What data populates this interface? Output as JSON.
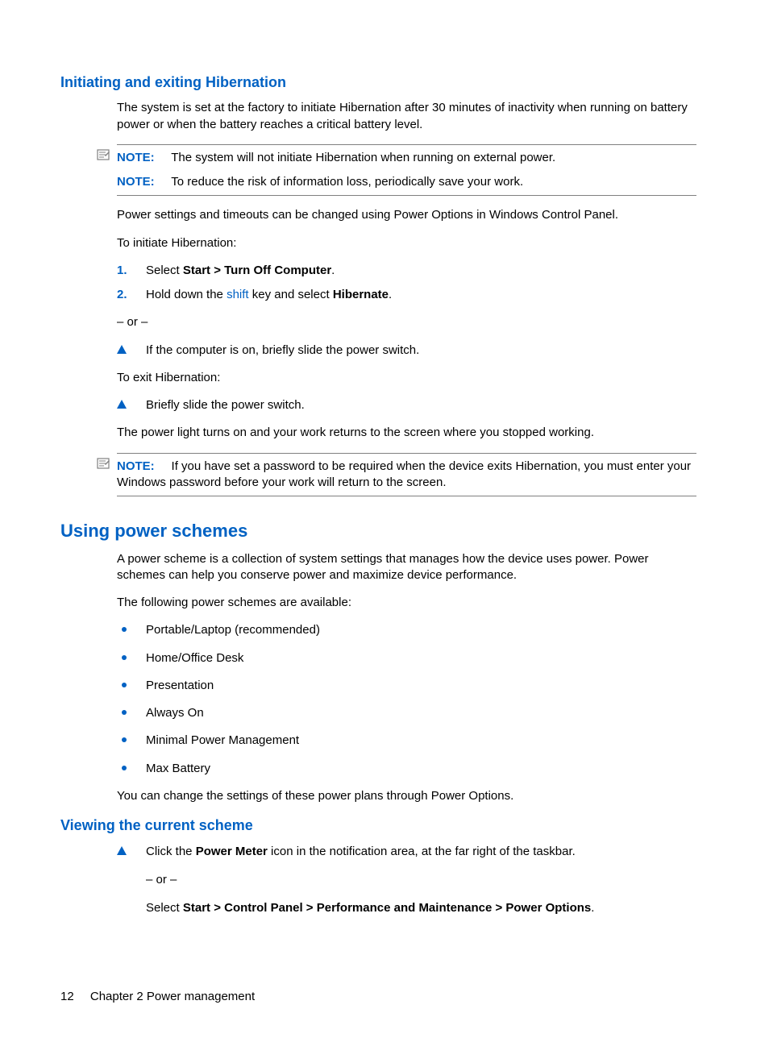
{
  "section1": {
    "heading": "Initiating and exiting Hibernation",
    "p1": "The system is set at the factory to initiate Hibernation after 30 minutes of inactivity when running on battery power or when the battery reaches a critical battery level.",
    "note1_label": "NOTE:",
    "note1_text": "The system will not initiate Hibernation when running on external power.",
    "note2_label": "NOTE:",
    "note2_text": "To reduce the risk of information loss, periodically save your work.",
    "p2": "Power settings and timeouts can be changed using Power Options in Windows Control Panel.",
    "p3": "To initiate Hibernation:",
    "step1_num": "1.",
    "step1_pre": "Select ",
    "step1_bold": "Start > Turn Off Computer",
    "step1_post": ".",
    "step2_num": "2.",
    "step2_pre": "Hold down the ",
    "step2_link": "shift",
    "step2_mid": " key and select ",
    "step2_bold": "Hibernate",
    "step2_post": ".",
    "or": "– or –",
    "tri1": "If the computer is on, briefly slide the power switch.",
    "p4": "To exit Hibernation:",
    "tri2": "Briefly slide the power switch.",
    "p5": "The power light turns on and your work returns to the screen where you stopped working.",
    "note3_label": "NOTE:",
    "note3_text": "If you have set a password to be required when the device exits Hibernation, you must enter your Windows password before your work will return to the screen."
  },
  "section2": {
    "heading": "Using power schemes",
    "p1": "A power scheme is a collection of system settings that manages how the device uses power. Power schemes can help you conserve power and maximize device performance.",
    "p2": "The following power schemes are available:",
    "items": [
      "Portable/Laptop (recommended)",
      "Home/Office Desk",
      "Presentation",
      "Always On",
      "Minimal Power Management",
      "Max Battery"
    ],
    "p3": "You can change the settings of these power plans through Power Options."
  },
  "section3": {
    "heading": "Viewing the current scheme",
    "tri_pre": "Click the ",
    "tri_bold": "Power Meter",
    "tri_post": " icon in the notification area, at the far right of the taskbar.",
    "or": "– or –",
    "sel_pre": "Select ",
    "sel_bold": "Start > Control Panel > Performance and Maintenance > Power Options",
    "sel_post": "."
  },
  "footer": {
    "page": "12",
    "chapter": "Chapter 2   Power management"
  }
}
